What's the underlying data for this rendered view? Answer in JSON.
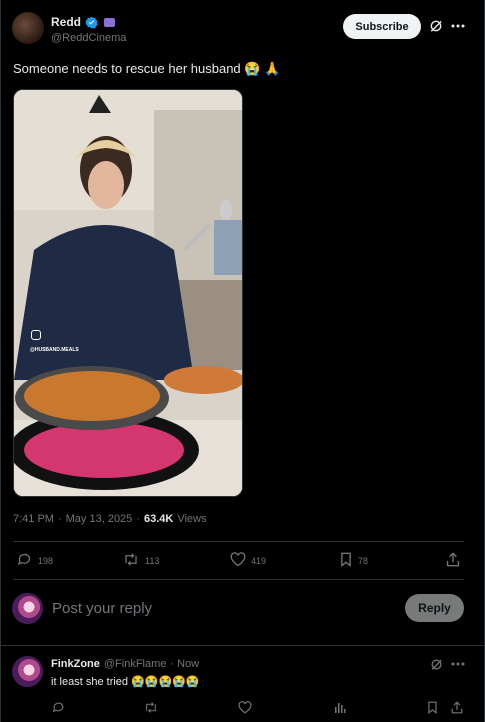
{
  "tweet": {
    "author_name": "Redd",
    "author_handle": "@ReddCinema",
    "subscribe_label": "Subscribe",
    "text": "Someone needs to rescue her husband 😭 🙏",
    "video_watermark": "@HUSBAND.MEALS",
    "time": "7:41 PM",
    "separator": "·",
    "date": "May 13, 2025",
    "views_count": "63.4K",
    "views_label": "Views"
  },
  "actions": {
    "replies": "198",
    "reposts": "113",
    "likes": "419",
    "bookmarks": "78"
  },
  "reply_box": {
    "placeholder": "Post your reply",
    "button_label": "Reply"
  },
  "reply": {
    "author_name": "FinkZone",
    "author_handle": "@FinkFlame",
    "time": "· Now",
    "text": "it least she tried 😭😭😭😭😭"
  },
  "colors": {
    "background": "#000000",
    "verified": "#1d9bf0",
    "muted": "#71767b",
    "divider": "#2f3336"
  }
}
